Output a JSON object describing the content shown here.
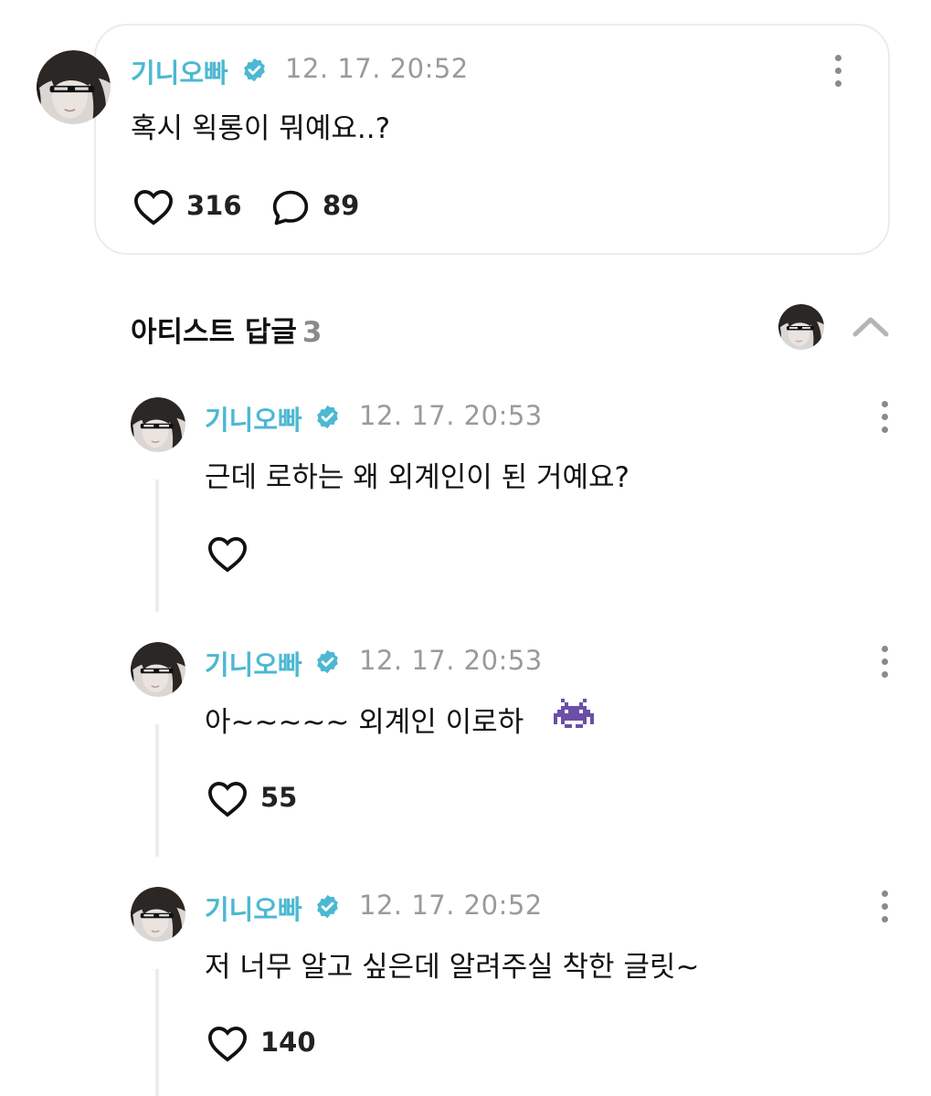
{
  "post": {
    "author": "기니오빠",
    "time": "12. 17. 20:52",
    "text": "혹시 왹롱이 뭐예요..?",
    "likes": "316",
    "comments": "89"
  },
  "section": {
    "title": "아티스트 답글",
    "count": "3"
  },
  "replies": [
    {
      "author": "기니오빠",
      "time": "12. 17. 20:53",
      "text": "근데 로하는 왜 외계인이 된 거예요?",
      "likes": ""
    },
    {
      "author": "기니오빠",
      "time": "12. 17. 20:53",
      "text": "아~~~~~ 외계인 이로하",
      "emoji": "alien-monster-icon",
      "likes": "55"
    },
    {
      "author": "기니오빠",
      "time": "12. 17. 20:52",
      "text": "저 너무 알고 싶은데 알려주실 착한 글릿~",
      "likes": "140"
    }
  ],
  "colors": {
    "author": "#4cb8d2",
    "verified": "#4cb8d2",
    "time": "#9a9a9a",
    "alien": "#6b4fa8"
  }
}
